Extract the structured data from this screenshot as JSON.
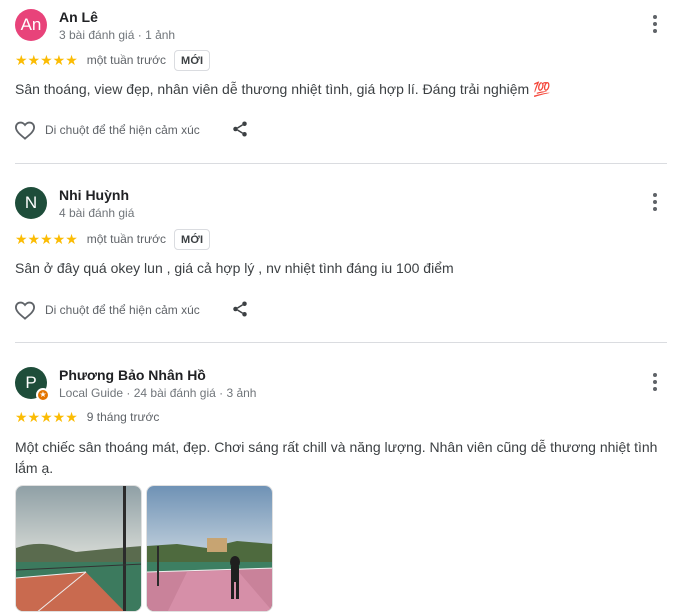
{
  "reviews": [
    {
      "avatar_letter": "An",
      "avatar_color": "#e8437a",
      "name": "An Lê",
      "meta": "3 bài đánh giá · 1 ảnh",
      "stars": "★★★★★",
      "rating": 5,
      "time": "một tuần trước",
      "badge": "MỚI",
      "text": "Sân thoáng, view đẹp, nhân viên dễ thương nhiệt tình, giá hợp lí. Đáng trải nghiệm 💯",
      "react_label": "Di chuột để thể hiện cảm xúc"
    },
    {
      "avatar_letter": "N",
      "avatar_color": "#1e4d3a",
      "name": "Nhi Huỳnh",
      "meta": "4 bài đánh giá",
      "stars": "★★★★★",
      "rating": 5,
      "time": "một tuần trước",
      "badge": "MỚI",
      "text": "Sân ở đây quá okey lun , giá cả hợp lý , nv nhiệt tình đáng iu 100 điểm",
      "react_label": "Di chuột để thể hiện cảm xúc"
    },
    {
      "avatar_letter": "P",
      "avatar_color": "#1e4d3a",
      "name": "Phương Bảo Nhân Hồ",
      "meta": "Local Guide · 24 bài đánh giá · 3 ảnh",
      "stars": "★★★★★",
      "rating": 5,
      "time": "9 tháng trước",
      "text": "Một chiếc sân thoáng mát, đẹp. Chơi sáng rất chill và năng lượng. Nhân viên cũng dễ thương nhiệt tình lắm ạ."
    }
  ],
  "colors": {
    "star": "#fbbc04",
    "divider": "#dadce0",
    "local_guide_badge": "#e37400"
  },
  "icons": [
    "more-vert-icon",
    "heart-outline-icon",
    "share-icon",
    "star-icon",
    "local-guide-badge-icon"
  ]
}
